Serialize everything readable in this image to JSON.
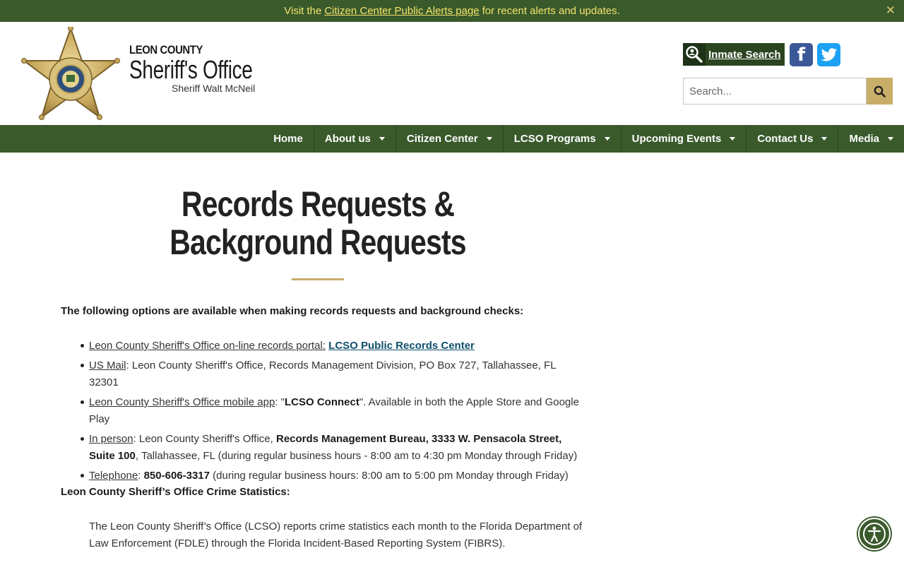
{
  "alert": {
    "prefix": "Visit the",
    "link": "Citizen Center Public Alerts page",
    "suffix": "for recent alerts and updates.",
    "close": "✕"
  },
  "brand": {
    "line1": "LEON COUNTY",
    "line2": "Sheriff's Office",
    "line3": "Sheriff Walt McNeil"
  },
  "header": {
    "inmate_search": "Inmate Search",
    "search_placeholder": "Search..."
  },
  "nav": {
    "items": [
      {
        "label": "Home"
      },
      {
        "label": "About us"
      },
      {
        "label": "Citizen Center"
      },
      {
        "label": "LCSO Programs"
      },
      {
        "label": "Upcoming Events"
      },
      {
        "label": "Contact Us"
      },
      {
        "label": "Media"
      }
    ]
  },
  "main": {
    "title": "Records Requests & Background Requests",
    "intro": "The following options are available when making records requests and background checks:",
    "options": {
      "portal_label": "Leon County Sheriff's Office on-line records portal:",
      "portal_link": "LCSO Public Records Center",
      "mail_label": "US Mail",
      "mail_text": ": Leon County Sheriff's Office, Records Management Division, PO Box 727, Tallahassee, FL 32301",
      "app_label": "Leon County Sheriff's Office mobile app",
      "app_text_1": ": \"",
      "app_name": "LCSO Connect",
      "app_text_2": "\". Available in both the Apple Store and Google Play",
      "person_label": "In person",
      "person_text_1": ": Leon County Sheriff's Office,",
      "person_bold": "Records Management Bureau, 3333 W. Pensacola Street, Suite 100",
      "person_text_2": ",  Tallahassee, FL (during regular business hours - 8:00 am to 4:30 pm Monday through Friday)",
      "phone_label": "Telephone",
      "phone_number": "850-606-3317",
      "phone_text": "(during regular business hours: 8:00 am to 5:00 pm Monday through Friday)"
    },
    "stats_heading": "Leon County Sheriff’s Office Crime Statistics:",
    "stats_body": "The Leon County Sheriff’s Office (LCSO) reports crime statistics each month to the Florida Department of Law Enforcement (FDLE) through the Florida Incident-Based Reporting System (FIBRS)."
  },
  "colors": {
    "green": "#3a5a2c",
    "gold": "#c9ae6a",
    "alert_text": "#f3e36a"
  },
  "icons": [
    "close-icon",
    "magnifier-person-icon",
    "facebook-icon",
    "twitter-icon",
    "search-icon",
    "caret-down-icon",
    "accessibility-icon"
  ]
}
